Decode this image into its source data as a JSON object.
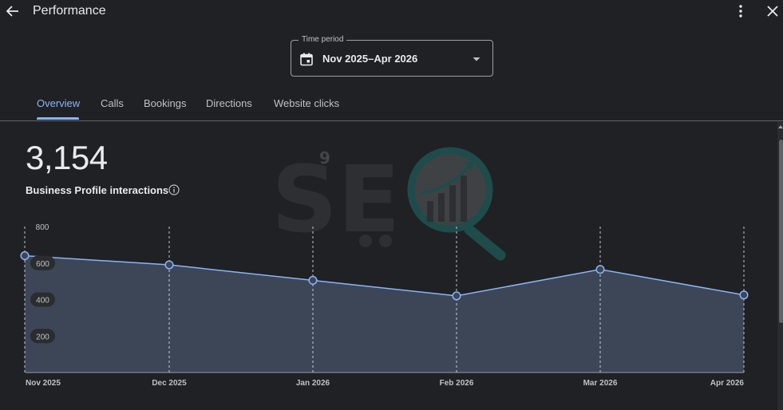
{
  "header": {
    "title": "Performance",
    "back_icon": "arrow-back-icon",
    "more_icon": "more-vert-icon",
    "close_icon": "close-icon"
  },
  "time_period": {
    "label": "Time period",
    "value": "Nov 2025–Apr 2026",
    "icon": "calendar-icon",
    "dropdown_icon": "caret-down-icon"
  },
  "tabs": [
    {
      "label": "Overview",
      "active": true
    },
    {
      "label": "Calls",
      "active": false
    },
    {
      "label": "Bookings",
      "active": false
    },
    {
      "label": "Directions",
      "active": false
    },
    {
      "label": "Website clicks",
      "active": false
    }
  ],
  "metric": {
    "value": "3,154",
    "label": "Business Profile interactions",
    "info_icon": "info-icon"
  },
  "watermark": {
    "text": "SE",
    "superscript": "9"
  },
  "colors": {
    "accent": "#8ab4f8",
    "fill": "#3c4657",
    "background": "#202124"
  },
  "chart_data": {
    "type": "area",
    "categories": [
      "Nov 2025",
      "Dec 2025",
      "Jan 2026",
      "Feb 2026",
      "Mar 2026",
      "Apr 2026"
    ],
    "values": [
      640,
      590,
      505,
      420,
      565,
      425
    ],
    "yticks": [
      "200",
      "400",
      "600",
      "800"
    ],
    "ytick_values": [
      200,
      400,
      600,
      800
    ],
    "ylim": [
      0,
      800
    ],
    "grid": "vertical dashed"
  }
}
